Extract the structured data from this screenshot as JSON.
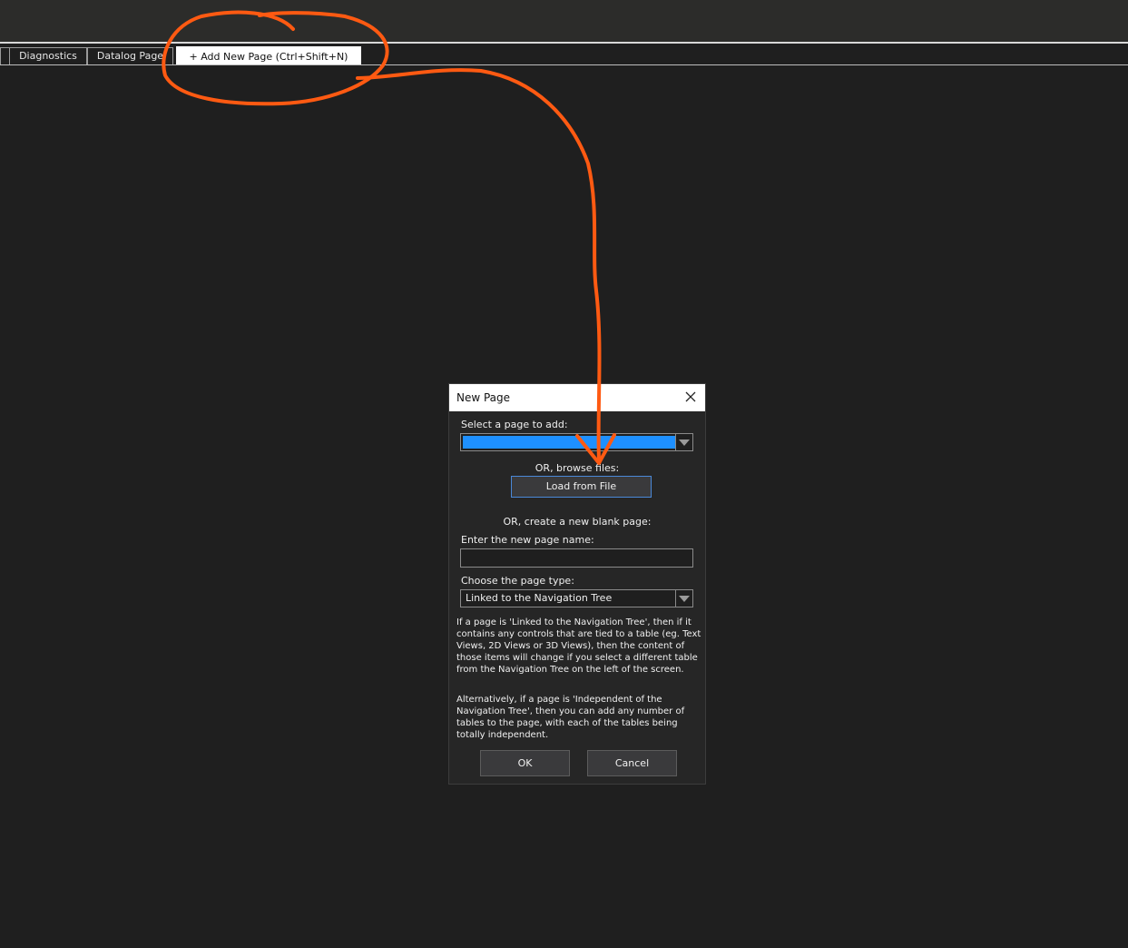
{
  "tabs": [
    {
      "label": "Diagnostics"
    },
    {
      "label": "Datalog Page"
    },
    {
      "label": "+ Add New Page (Ctrl+Shift+N)"
    }
  ],
  "dialog": {
    "title": "New Page",
    "select_label": "Select a page to add:",
    "browse_label": "OR, browse files:",
    "load_button": "Load from File",
    "blank_label": "OR, create a new blank page:",
    "name_label": "Enter the new page name:",
    "name_value": "",
    "type_label": "Choose the page type:",
    "type_value": "Linked to the Navigation Tree",
    "help_linked": "If a page is 'Linked to the Navigation Tree', then if it contains any controls that are tied to a table (eg. Text Views, 2D Views or 3D Views), then the content of those items will change if you select a different table from the Navigation Tree on the left of the screen.",
    "help_independent": "Alternatively, if a page is 'Independent of the Navigation Tree', then you can add any number of tables to the page, with each of the tables being totally independent.",
    "ok_button": "OK",
    "cancel_button": "Cancel"
  },
  "colors": {
    "annotation": "#ff5a12",
    "selection": "#1e90ff"
  }
}
